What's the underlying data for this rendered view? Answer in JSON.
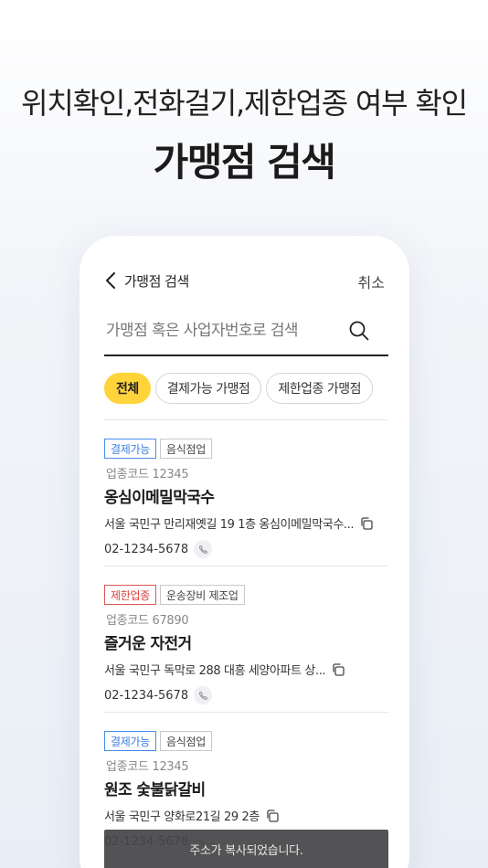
{
  "hero": {
    "subtitle": "위치확인,전화걸기,제한업종 여부 확인",
    "title": "가맹점 검색"
  },
  "topbar": {
    "title": "가맹점 검색",
    "cancel_label": "취소"
  },
  "search": {
    "placeholder": "가맹점 혹은 사업자번호로 검색",
    "value": ""
  },
  "filters": [
    {
      "label": "전체",
      "active": true
    },
    {
      "label": "결제가능 가맹점",
      "active": false
    },
    {
      "label": "제한업종 가맹점",
      "active": false
    }
  ],
  "stores": [
    {
      "status_badge": "결제가능",
      "status_type": "ok",
      "category": "음식점업",
      "code": "업종코드 12345",
      "name": "옹심이메밀막국수",
      "address": "서울 국민구 만리재옛길 19 1층 옹심이메밀막국수...",
      "tel": "02-1234-5678"
    },
    {
      "status_badge": "제한업종",
      "status_type": "ban",
      "category": "운송장비 제조업",
      "code": "업종코드 67890",
      "name": "즐거운 자전거",
      "address": "서울 국민구 독막로 288 대흥 세양아파트 상...",
      "tel": "02-1234-5678"
    },
    {
      "status_badge": "결제가능",
      "status_type": "ok",
      "category": "음식점업",
      "code": "업종코드 12345",
      "name": "원조 숯불닭갈비",
      "address": "서울 국민구 양화로21길 29 2층",
      "tel": "02-1234-5678"
    }
  ],
  "toast": "주소가 복사되었습니다.",
  "colors": {
    "accent": "#ffd43b",
    "ok": "#3b7fe0",
    "ban": "#d94040"
  }
}
